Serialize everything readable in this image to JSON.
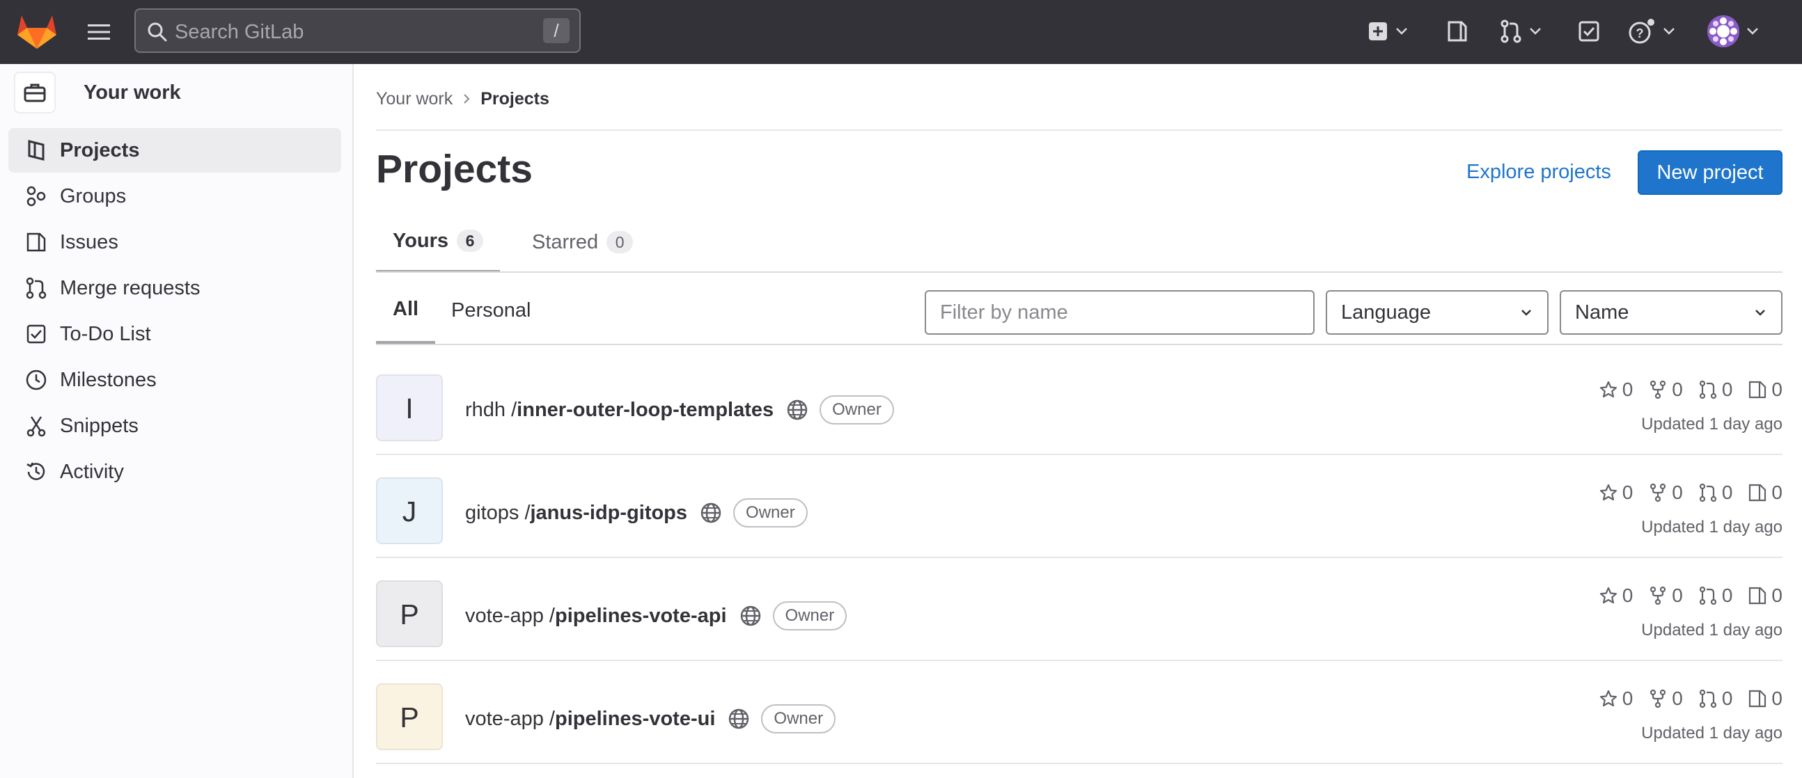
{
  "topbar": {
    "search_placeholder": "Search GitLab",
    "search_shortcut": "/",
    "icons": [
      "gitlab-logo",
      "hamburger-icon",
      "search-icon",
      "plus-square-icon",
      "issues-icon",
      "merge-request-icon",
      "todo-icon",
      "help-icon",
      "user-avatar"
    ]
  },
  "sidebar": {
    "context_label": "Your work",
    "items": [
      {
        "label": "Projects",
        "icon": "project-icon",
        "active": true
      },
      {
        "label": "Groups",
        "icon": "group-icon"
      },
      {
        "label": "Issues",
        "icon": "issues-icon"
      },
      {
        "label": "Merge requests",
        "icon": "merge-request-icon"
      },
      {
        "label": "To-Do List",
        "icon": "todo-icon"
      },
      {
        "label": "Milestones",
        "icon": "clock-icon"
      },
      {
        "label": "Snippets",
        "icon": "snippet-icon"
      },
      {
        "label": "Activity",
        "icon": "history-icon"
      }
    ]
  },
  "breadcrumb": {
    "items": [
      "Your work",
      "Projects"
    ]
  },
  "page": {
    "title": "Projects",
    "explore_label": "Explore projects",
    "new_project_label": "New project"
  },
  "tabs": [
    {
      "label": "Yours",
      "count": "6",
      "active": true
    },
    {
      "label": "Starred",
      "count": "0",
      "active": false
    }
  ],
  "filters": {
    "name_placeholder": "Filter by name",
    "language_label": "Language",
    "sort_label": "Name"
  },
  "subtabs": [
    {
      "label": "All",
      "active": true
    },
    {
      "label": "Personal",
      "active": false
    }
  ],
  "projects": [
    {
      "initial": "I",
      "namespace": "rhdh",
      "name": "inner-outer-loop-templates",
      "role": "Owner",
      "stars": "0",
      "forks": "0",
      "merge_requests": "0",
      "issues": "0",
      "updated": "Updated 1 day ago",
      "tile_color": "#f0f0fb"
    },
    {
      "initial": "J",
      "namespace": "gitops",
      "name": "janus-idp-gitops",
      "role": "Owner",
      "stars": "0",
      "forks": "0",
      "merge_requests": "0",
      "issues": "0",
      "updated": "Updated 1 day ago",
      "tile_color": "#eaf2fa"
    },
    {
      "initial": "P",
      "namespace": "vote-app",
      "name": "pipelines-vote-api",
      "role": "Owner",
      "stars": "0",
      "forks": "0",
      "merge_requests": "0",
      "issues": "0",
      "updated": "Updated 1 day ago",
      "tile_color": "#ececef"
    },
    {
      "initial": "P",
      "namespace": "vote-app",
      "name": "pipelines-vote-ui",
      "role": "Owner",
      "stars": "0",
      "forks": "0",
      "merge_requests": "0",
      "issues": "0",
      "updated": "Updated 1 day ago",
      "tile_color": "#fbf3e1"
    }
  ],
  "colors": {
    "topbar": "#333238",
    "primary": "#1f75cb",
    "sidebar": "#fbfafd"
  }
}
